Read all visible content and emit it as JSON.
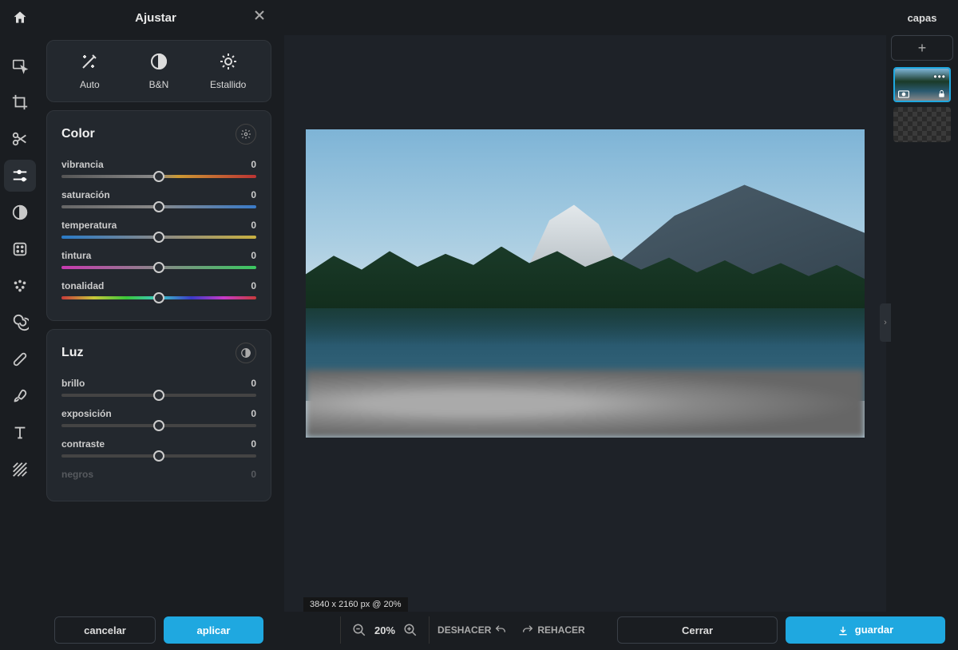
{
  "header": {
    "panel_title": "Ajustar",
    "layers_title": "capas"
  },
  "quick": {
    "auto": "Auto",
    "bn": "B&N",
    "burst": "Estallido"
  },
  "sections": {
    "color": {
      "title": "Color",
      "sliders": {
        "vibrancia": {
          "label": "vibrancia",
          "value": "0"
        },
        "saturacion": {
          "label": "saturación",
          "value": "0"
        },
        "temperatura": {
          "label": "temperatura",
          "value": "0"
        },
        "tintura": {
          "label": "tintura",
          "value": "0"
        },
        "tonalidad": {
          "label": "tonalidad",
          "value": "0"
        }
      }
    },
    "luz": {
      "title": "Luz",
      "sliders": {
        "brillo": {
          "label": "brillo",
          "value": "0"
        },
        "exposicion": {
          "label": "exposición",
          "value": "0"
        },
        "contraste": {
          "label": "contraste",
          "value": "0"
        },
        "negros": {
          "label": "negros",
          "value": "0"
        }
      }
    }
  },
  "panel_footer": {
    "cancel": "cancelar",
    "apply": "aplicar"
  },
  "canvas": {
    "dimensions": "3840 x 2160 px @ 20%"
  },
  "bottom": {
    "zoom": "20%",
    "undo": "DESHACER",
    "redo": "REHACER",
    "close": "Cerrar",
    "save": "guardar"
  }
}
